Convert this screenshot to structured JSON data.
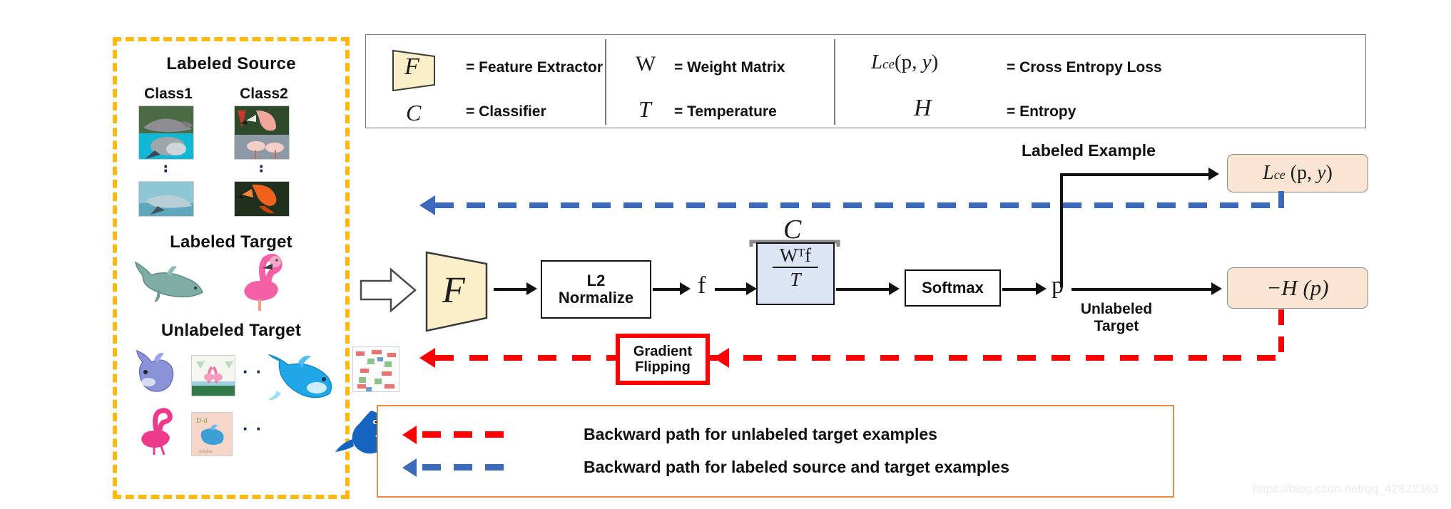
{
  "left_panel": {
    "title_source": "Labeled Source",
    "class1": "Class1",
    "class2": "Class2",
    "dots": "·",
    "title_labeled_target": "Labeled Target",
    "title_unlabeled_target": "Unlabeled Target",
    "border_color": "#FDB813",
    "thumbs": {
      "src_c1_top": "dolphin-photo",
      "src_c1_bottom": "dolphin-photo-2",
      "src_c2_top": "flamingo-photo",
      "src_c2_bottom": "flamingo-photo-2",
      "lt_1": "dolphin-clipart",
      "lt_2": "flamingo-clipart",
      "ut_1": "dolphin-cartoon",
      "ut_2": "flamingo-painting",
      "ut_3": "flamingo-sketch",
      "ut_4": "dolphin-drawing",
      "ut_5": "dolphin-blue-clipart",
      "ut_6": "flamingo-pattern",
      "ut_7": "dolphin-blue-sketch"
    }
  },
  "legend_top": {
    "items": [
      {
        "symbol": "F",
        "equals": "= Feature Extractor"
      },
      {
        "symbol": "C",
        "equals": "= Classifier"
      },
      {
        "symbol": "W",
        "equals": "= Weight Matrix"
      },
      {
        "symbol": "T",
        "equals": "= Temperature"
      },
      {
        "symbol": "L_ce(p, y)",
        "equals": "= Cross Entropy Loss"
      },
      {
        "symbol": "H",
        "equals": "= Entropy"
      }
    ],
    "border_color": "#7a7a7a"
  },
  "pipeline": {
    "feature_extractor_symbol": "F",
    "l2_normalize_line1": "L2",
    "l2_normalize_line2": "Normalize",
    "feature_symbol": "f",
    "classifier_symbol": "C",
    "classifier_numerator": "Wᵀf",
    "classifier_denominator": "T",
    "softmax_label": "Softmax",
    "prediction_symbol": "p",
    "labeled_example_label": "Labeled Example",
    "unlabeled_target_line1": "Unlabeled",
    "unlabeled_target_line2": "Target",
    "ce_loss_box": "L_ce (p, y)",
    "entropy_box": "−H (p)",
    "gradient_flipping_line1": "Gradient",
    "gradient_flipping_line2": "Flipping",
    "gradient_flipping_border": "#FF0000",
    "blue_path_color": "#3C6AB8",
    "red_path_color": "#FF0000",
    "fe_fill": "#FAEFC8",
    "classifier_fill": "#DCE5F3",
    "loss_fill": "#FAE5D3"
  },
  "legend_bottom": {
    "border_color": "#E8893B",
    "rows": [
      {
        "color": "#FF0000",
        "text": "Backward path for unlabeled target examples"
      },
      {
        "color": "#3C6AB8",
        "text": "Backward path for labeled source and target examples"
      }
    ]
  },
  "watermark": {
    "text": "https://blog.csdn.net/qq_42822363"
  }
}
